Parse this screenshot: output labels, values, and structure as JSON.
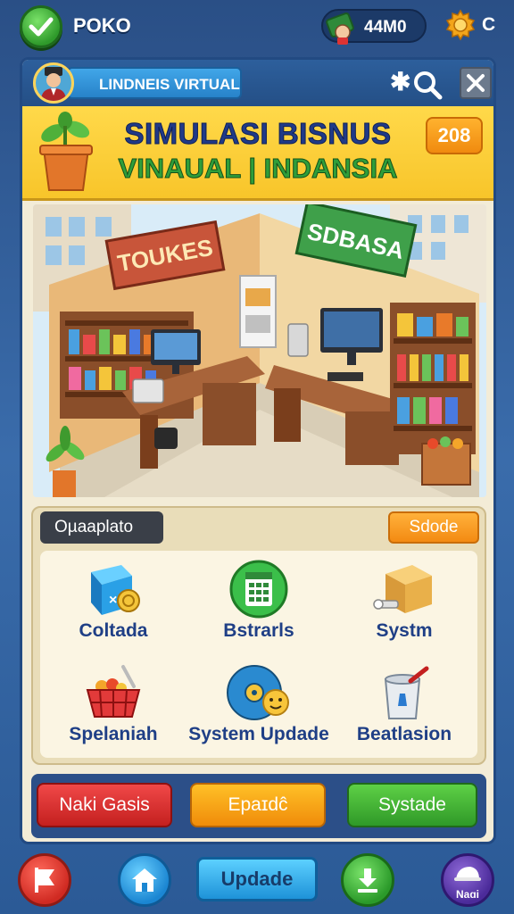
{
  "topbar": {
    "player_name": "POKO",
    "coins": "44M0",
    "gear_letter": "C"
  },
  "panel": {
    "profile_label": "LINDNEIS VIRTUAL",
    "banner_title": "SIMULASI BISNUS",
    "banner_subtitle": "VINAUAL | INDANSIA",
    "level": "208"
  },
  "scene": {
    "sign_left": "TOUKES",
    "sign_right": "SDBASA"
  },
  "actions": {
    "section_label": "Oµaaplato",
    "sort_label": "Sdode",
    "tiles": [
      {
        "label": "Coltada",
        "icon": "cash-register-icon"
      },
      {
        "label": "Bstrarls",
        "icon": "calendar-icon"
      },
      {
        "label": "Systm",
        "icon": "box-icon"
      },
      {
        "label": "Spelaniah",
        "icon": "basket-icon"
      },
      {
        "label": "System Updade",
        "icon": "disc-icon"
      },
      {
        "label": "Beatlasion",
        "icon": "bucket-icon"
      }
    ],
    "buttons": {
      "red": "Naki Gasis",
      "orange": "Epaɪdĉ",
      "green": "Systade"
    }
  },
  "bottom_nav": {
    "update_label": "Updade",
    "profile_label": "Naɑi"
  }
}
